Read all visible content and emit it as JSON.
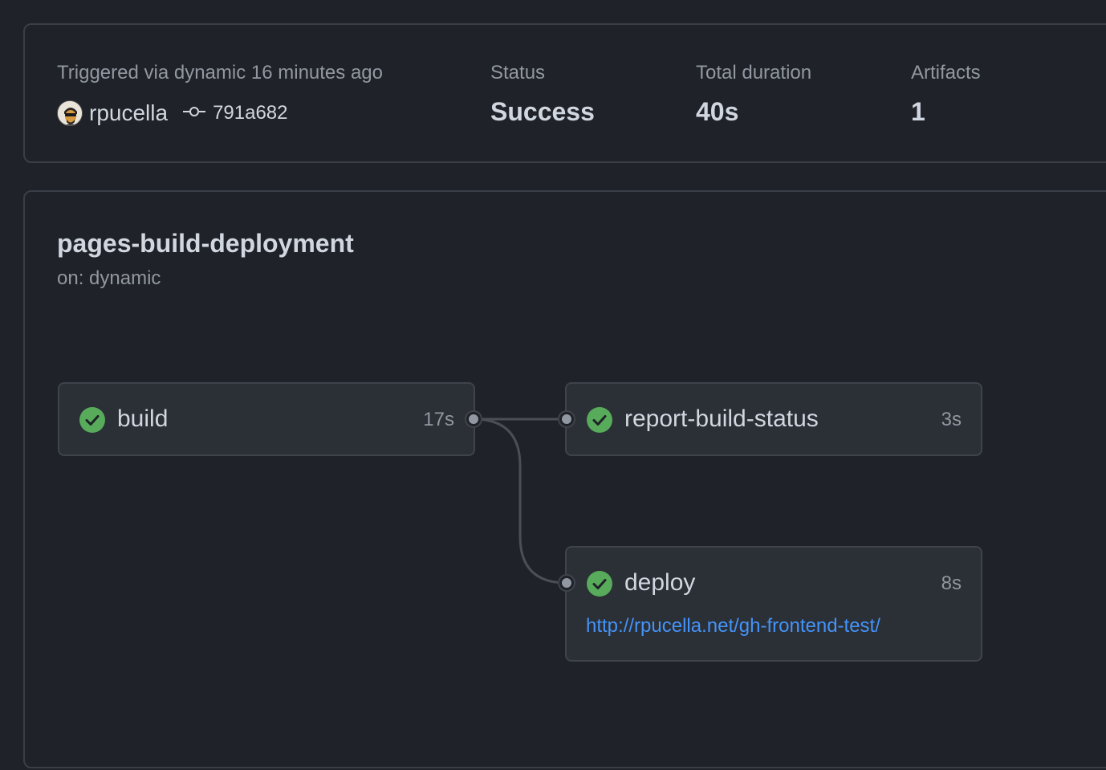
{
  "summary": {
    "trigger_text": "Triggered via dynamic 16 minutes ago",
    "actor": "rpucella",
    "commit_sha": "791a682",
    "status_label": "Status",
    "status_value": "Success",
    "duration_label": "Total duration",
    "duration_value": "40s",
    "artifacts_label": "Artifacts",
    "artifacts_value": "1"
  },
  "workflow": {
    "name": "pages-build-deployment",
    "trigger": "on: dynamic",
    "jobs": [
      {
        "name": "build",
        "duration": "17s",
        "status": "success"
      },
      {
        "name": "report-build-status",
        "duration": "3s",
        "status": "success"
      },
      {
        "name": "deploy",
        "duration": "8s",
        "status": "success",
        "environment_url": "http://rpucella.net/gh-frontend-test/"
      }
    ]
  },
  "colors": {
    "success": "#57ab5a",
    "link": "#4493f8",
    "background": "#1f2228",
    "card": "#2b2f36"
  },
  "icons": {
    "status": "check-circle-icon",
    "commit": "git-commit-icon"
  }
}
